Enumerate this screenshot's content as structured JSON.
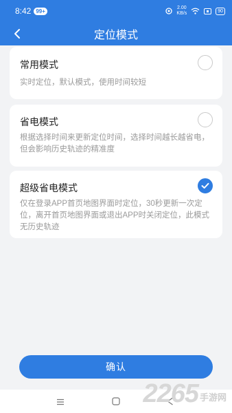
{
  "status_bar": {
    "time": "8:42",
    "notif_badge": "99+",
    "speed_value": "2.00",
    "speed_unit": "KB/s",
    "battery": "90"
  },
  "header": {
    "title": "定位模式",
    "back_icon": "chevron-left-icon"
  },
  "modes": [
    {
      "name": "常用模式",
      "desc": "实时定位，默认模式，使用时间较短",
      "selected": false
    },
    {
      "name": "省电模式",
      "desc": "根据选择时间来更新定位时间，选择时间越长越省电，但会影响历史轨迹的精准度",
      "selected": false
    },
    {
      "name": "超级省电模式",
      "desc": "仅在登录APP首页地图界面时定位，30秒更新一次定位，离开首页地图界面或退出APP时关闭定位，此模式无历史轨迹",
      "selected": true
    }
  ],
  "confirm_label": "确认",
  "watermark": {
    "number": "2265",
    "suffix": "手游网"
  },
  "colors": {
    "accent": "#2f7de1",
    "background": "#f2f3f5",
    "muted_text": "#9a9a9a"
  }
}
